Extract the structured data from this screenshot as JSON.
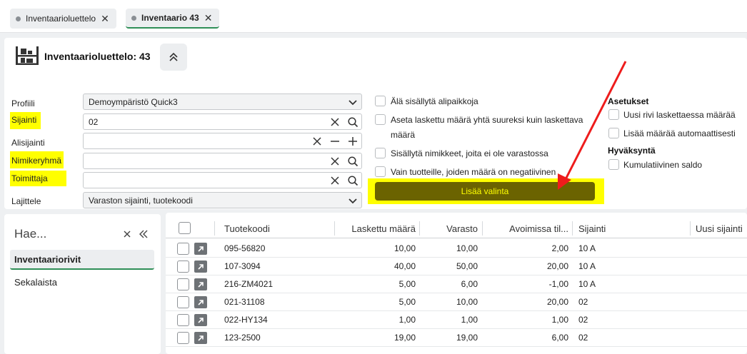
{
  "tabs": [
    {
      "label": "Inventaarioluettelo",
      "active": false
    },
    {
      "label": "Inventaario 43",
      "active": true
    }
  ],
  "header": {
    "title": "Inventaarioluettelo: 43",
    "icon": "warehouse-shelves-icon",
    "collapse_icon": "double-chevron-up-icon"
  },
  "filters": {
    "profiili": {
      "label": "Profiili",
      "value": "Demoympäristö Quick3"
    },
    "sijainti": {
      "label": "Sijainti",
      "value": "02"
    },
    "alisijainti": {
      "label": "Alisijainti",
      "value": ""
    },
    "nimikeryhma": {
      "label": "Nimikeryhmä",
      "value": ""
    },
    "toimittaja": {
      "label": "Toimittaja",
      "value": ""
    },
    "lajittele": {
      "label": "Lajittele",
      "value": "Varaston sijainti, tuotekoodi"
    }
  },
  "options": {
    "alipaikat": "Älä sisällytä alipaikkoja",
    "laskettu_line1": "Aseta laskettu määrä yhtä suureksi kuin laskettava",
    "laskettu_line2": "määrä",
    "ei_varastossa": "Sisällytä nimikkeet, joita ei ole varastossa",
    "negatiivinen": "Vain tuotteille, joiden määrä on negatiivinen"
  },
  "settings": {
    "title": "Asetukset",
    "uusi_rivi": "Uusi rivi laskettaessa määrää",
    "lisaa_maara": "Lisää määrää automaattisesti",
    "approval_title": "Hyväksyntä",
    "kumulatiivinen": "Kumulatiivinen saldo"
  },
  "add_button": "Lisää valinta",
  "highlight_color": "#ffff00",
  "button_color": "#6b6300",
  "accent_color": "#2f8f57",
  "leftnav": {
    "search_placeholder": "Hae...",
    "items": [
      "Inventaariorivit",
      "Sekalaista"
    ]
  },
  "grid": {
    "columns": [
      "Tuotekoodi",
      "Laskettu määrä",
      "Varasto",
      "Avoimissa til...",
      "Sijainti",
      "Uusi sijainti"
    ],
    "rows": [
      [
        "095-56820",
        "10,00",
        "10,00",
        "2,00",
        "10 A"
      ],
      [
        "107-3094",
        "40,00",
        "50,00",
        "20,00",
        "10 A"
      ],
      [
        "216-ZM4021",
        "5,00",
        "6,00",
        "-1,00",
        "10 A"
      ],
      [
        "021-31108",
        "5,00",
        "10,00",
        "20,00",
        "02"
      ],
      [
        "022-HY134",
        "1,00",
        "1,00",
        "1,00",
        "02"
      ],
      [
        "123-2500",
        "19,00",
        "19,00",
        "6,00",
        "02"
      ]
    ]
  }
}
